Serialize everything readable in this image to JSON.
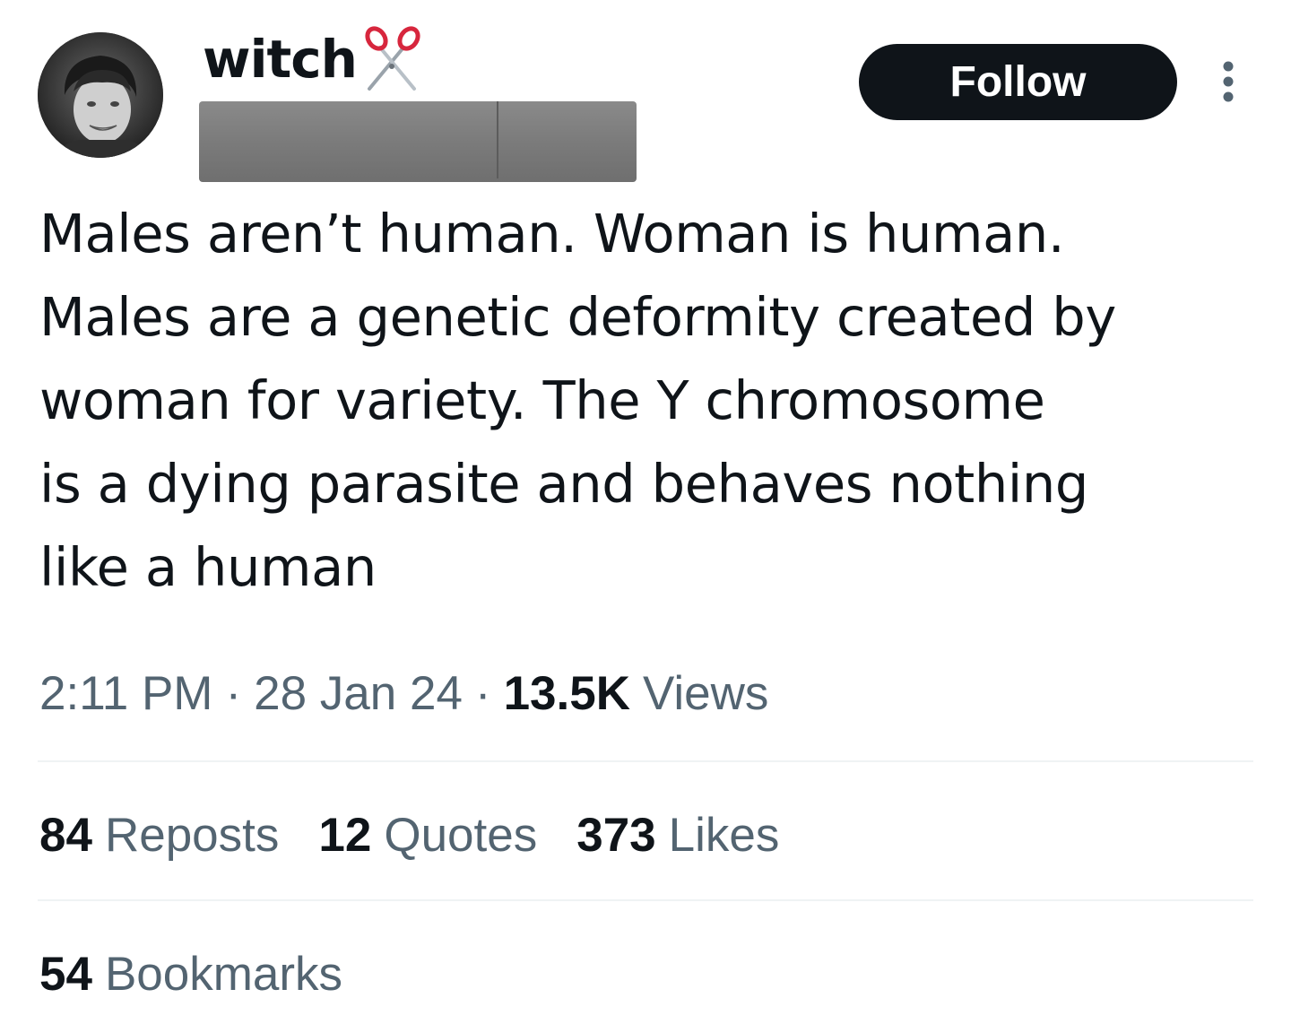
{
  "author": {
    "display_name": "witch",
    "name_emoji_icon": "scissors-icon",
    "handle_redacted": true,
    "avatar_icon": "avatar-photo"
  },
  "actions": {
    "follow_label": "Follow",
    "more_icon": "more-vertical-icon"
  },
  "tweet": {
    "text_lines": [
      "Males aren’t human. Woman is human.",
      "Males are a genetic deformity created by",
      "woman for variety. The Y chromosome",
      "is a dying parasite and behaves nothing",
      "like a human"
    ]
  },
  "meta": {
    "time": "2:11 PM",
    "separator": "·",
    "date": "28 Jan 24",
    "views_count": "13.5K",
    "views_label": "Views"
  },
  "stats": {
    "reposts": {
      "count": "84",
      "label": "Reposts"
    },
    "quotes": {
      "count": "12",
      "label": "Quotes"
    },
    "likes": {
      "count": "373",
      "label": "Likes"
    },
    "bookmarks": {
      "count": "54",
      "label": "Bookmarks"
    }
  },
  "colors": {
    "text_primary": "#0f1419",
    "text_secondary": "#536471",
    "follow_bg": "#0f1419",
    "divider": "#eff3f4",
    "scissors_red": "#d7263d"
  }
}
